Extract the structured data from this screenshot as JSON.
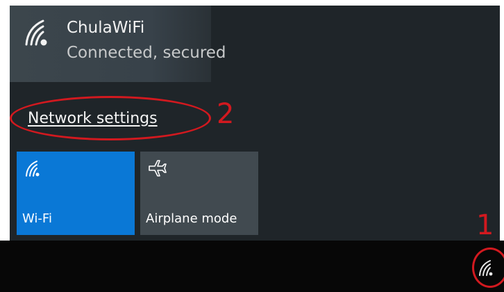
{
  "network": {
    "name": "ChulaWiFi",
    "status": "Connected, secured",
    "icon": "wifi-secured-icon"
  },
  "links": {
    "network_settings": "Network settings"
  },
  "quick_actions": [
    {
      "label": "Wi-Fi",
      "icon": "wifi-icon",
      "active": true
    },
    {
      "label": "Airplane mode",
      "icon": "airplane-icon",
      "active": false
    }
  ],
  "taskbar": {
    "tray_icon": "wifi-tray-icon"
  },
  "annotations": {
    "step_1": "1",
    "step_2": "2",
    "color": "#d2191f"
  },
  "colors": {
    "flyout_bg": "#1f2529",
    "network_item_bg": "#3c464c",
    "wifi_tile_active": "#0a78d6",
    "airplane_tile": "#414a50",
    "taskbar_bg": "#070707"
  }
}
